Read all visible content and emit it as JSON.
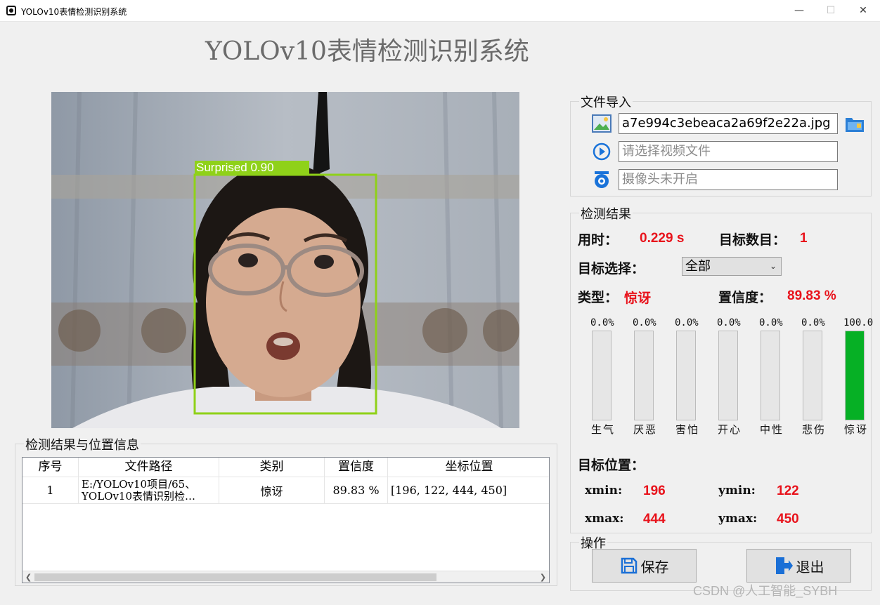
{
  "window": {
    "title": "YOLOv10表情检测识别系统",
    "minimize": "—",
    "maximize": "☐",
    "close": "✕"
  },
  "app_title": "YOLOv10表情检测识别系统",
  "detection_overlay": {
    "label": "Surprised 0.90"
  },
  "file_import": {
    "title": "文件导入",
    "image_path": "a7e994c3ebeaca2a69f2e22a.jpg",
    "video_placeholder": "请选择视频文件",
    "camera_placeholder": "摄像头未开启"
  },
  "results": {
    "title": "检测结果",
    "time_label": "用时：",
    "time_value": "0.229 s",
    "count_label": "目标数目：",
    "count_value": "1",
    "select_label": "目标选择：",
    "select_value": "全部",
    "type_label": "类型：",
    "type_value": "惊讶",
    "conf_label": "置信度：",
    "conf_value": "89.83 %",
    "bars": [
      {
        "name": "生气",
        "pct_text": "0.0%",
        "fraction": 0.0
      },
      {
        "name": "厌恶",
        "pct_text": "0.0%",
        "fraction": 0.0
      },
      {
        "name": "害怕",
        "pct_text": "0.0%",
        "fraction": 0.0
      },
      {
        "name": "开心",
        "pct_text": "0.0%",
        "fraction": 0.0
      },
      {
        "name": "中性",
        "pct_text": "0.0%",
        "fraction": 0.0
      },
      {
        "name": "悲伤",
        "pct_text": "0.0%",
        "fraction": 0.0
      },
      {
        "name": "惊讶",
        "pct_text": "100.0",
        "fraction": 1.0
      }
    ],
    "position_label": "目标位置：",
    "xmin_label": "xmin:",
    "xmin_value": "196",
    "ymin_label": "ymin:",
    "ymin_value": "122",
    "xmax_label": "xmax:",
    "xmax_value": "444",
    "ymax_label": "ymax:",
    "ymax_value": "450"
  },
  "operations": {
    "title": "操作",
    "save_label": "保存",
    "exit_label": "退出"
  },
  "table": {
    "title": "检测结果与位置信息",
    "headers": [
      "序号",
      "文件路径",
      "类别",
      "置信度",
      "坐标位置"
    ],
    "rows": [
      {
        "index": "1",
        "path": "E:/YOLOv10项目/65、YOLOv10表情识别检…",
        "class": "惊讶",
        "confidence": "89.83 %",
        "coords": "[196, 122, 444, 450]"
      }
    ]
  },
  "colors": {
    "bar_fill": "#06b025",
    "value_red": "#e8121b",
    "box_green": "#8fd119"
  },
  "watermark": "CSDN @人工智能_SYBH"
}
